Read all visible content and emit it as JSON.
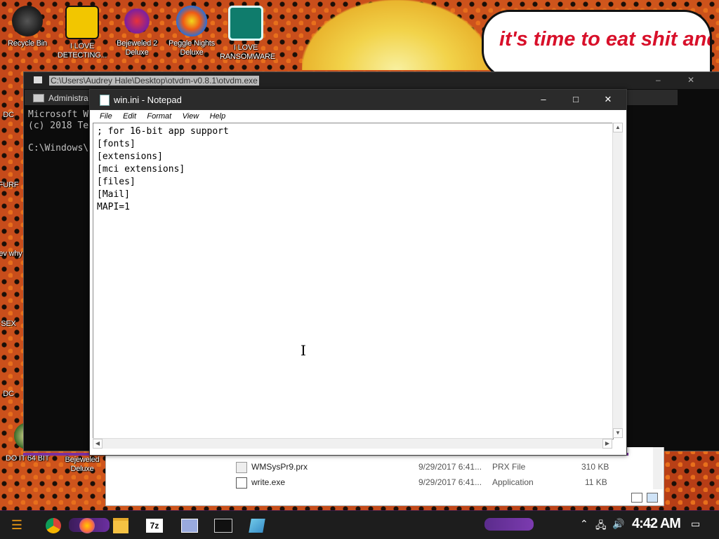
{
  "wallpaper": {
    "speech_text": "it's time to eat shit and die and chew"
  },
  "desktop_icons": [
    {
      "label": "Recycle Bin",
      "icon": "recycle-bin-icon"
    },
    {
      "label": "I LOVE DETECTING...",
      "icon": "de-icon"
    },
    {
      "label": "Bejeweled 2 Deluxe",
      "icon": "bejeweled-icon"
    },
    {
      "label": "Peggle Nights Deluxe",
      "icon": "peggle-icon"
    },
    {
      "label": "I LOVE RANSOMWARE",
      "icon": "publisher-icon"
    },
    {
      "label": "DO IT 64 BIT",
      "icon": "figure-icon"
    },
    {
      "label": "Bejeweled Deluxe",
      "icon": "bejeweled-icon"
    }
  ],
  "left_edge_labels": [
    "DC",
    "FURF",
    "nev why",
    "SEX",
    "DC"
  ],
  "otvdm_window": {
    "title": "C:\\Users\\Audrey Hale\\Desktop\\otvdm-v0.8.1\\otvdm.exe"
  },
  "cmd_window": {
    "title": "Administra",
    "lines": [
      "Microsoft W",
      "(c) 2018 Te",
      "",
      "C:\\Windows\\"
    ]
  },
  "explorer": {
    "rows": [
      {
        "name": "WMSysPr9.prx",
        "date": "9/29/2017 6:41...",
        "type": "PRX File",
        "size": "310 KB"
      },
      {
        "name": "write.exe",
        "date": "9/29/2017 6:41...",
        "type": "Application",
        "size": "11 KB"
      }
    ]
  },
  "notepad": {
    "title": "win.ini - Notepad",
    "menu": [
      "File",
      "Edit",
      "Format",
      "View",
      "Help"
    ],
    "content": "; for 16-bit app support\n[fonts]\n[extensions]\n[mci extensions]\n[files]\n[Mail]\nMAPI=1",
    "controls": {
      "minimize": "–",
      "maximize": "□",
      "close": "✕"
    }
  },
  "taskbar": {
    "apps": [
      "start-icon",
      "chrome-icon",
      "firefox-icon",
      "file-explorer-icon",
      "7zip-icon",
      "write-icon",
      "cmd-icon",
      "notepad-icon"
    ],
    "zip_label": "7z",
    "clock": "4:42 AM"
  },
  "colors": {
    "accent": "#7a2fa0",
    "titlebar": "#2b2b2b"
  }
}
